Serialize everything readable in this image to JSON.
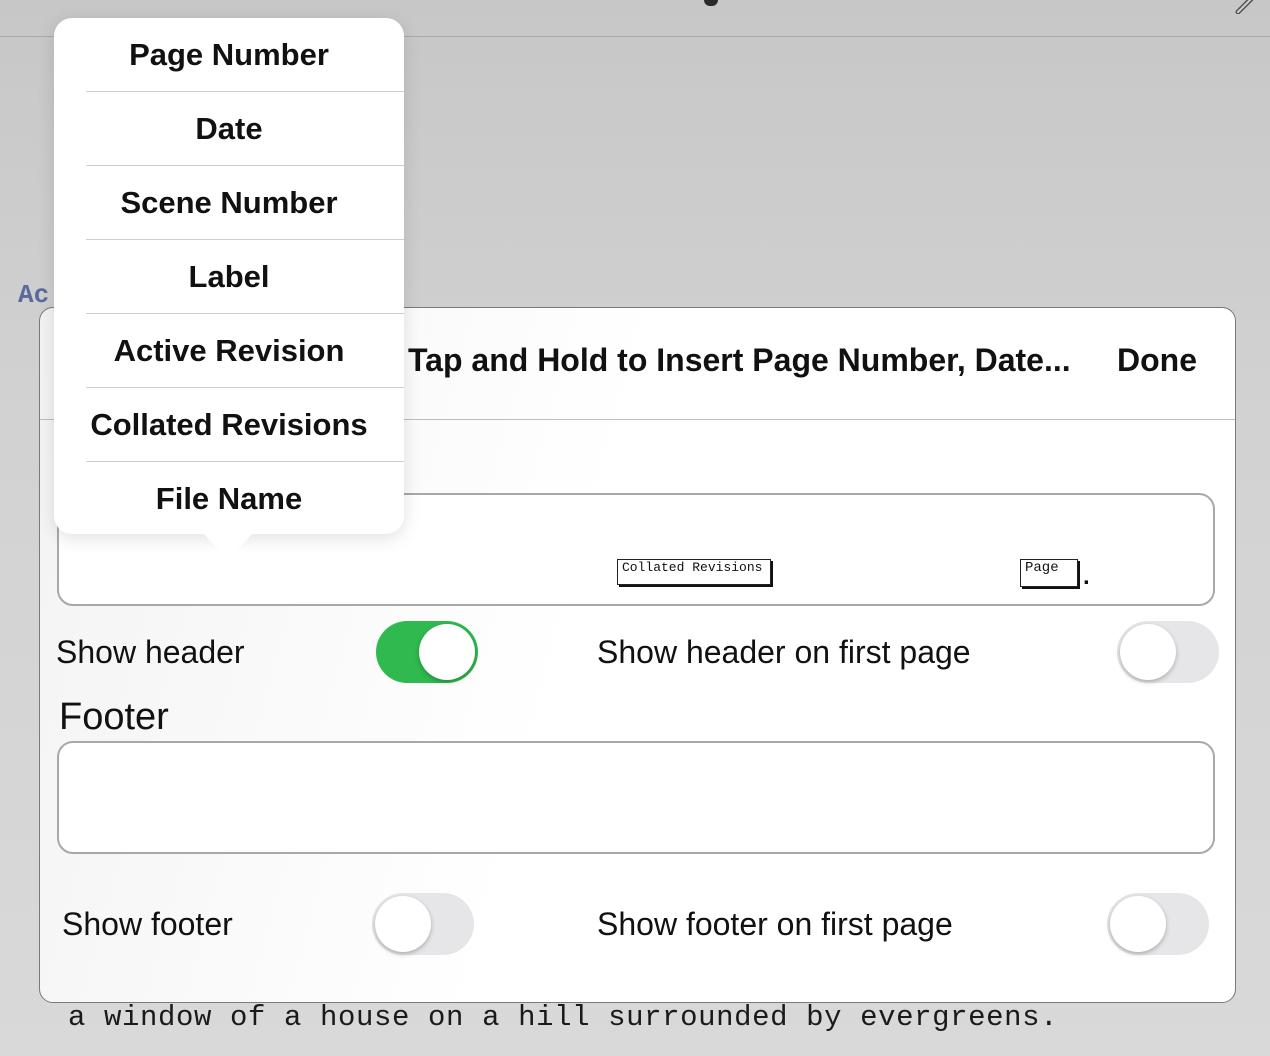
{
  "background": {
    "partial_heading": "Ac",
    "script_line": "a window of a house on a hill surrounded by evergreens."
  },
  "modal": {
    "instruction": "Tap and Hold to Insert Page Number, Date...",
    "done_label": "Done",
    "header_field": {
      "tokens": [
        "Collated Revisions",
        "Page"
      ],
      "trailing_text": "."
    },
    "show_header_label": "Show header",
    "show_header_on": true,
    "show_header_first_label": "Show header on first page",
    "show_header_first_on": false,
    "footer_label": "Footer",
    "footer_value": "",
    "show_footer_label": "Show footer",
    "show_footer_on": false,
    "show_footer_first_label": "Show footer on first page",
    "show_footer_first_on": false
  },
  "popover": {
    "items": [
      {
        "label": "Page Number"
      },
      {
        "label": "Date"
      },
      {
        "label": "Scene Number"
      },
      {
        "label": "Label"
      },
      {
        "label": "Active Revision"
      },
      {
        "label": "Collated Revisions"
      },
      {
        "label": "File Name"
      }
    ]
  },
  "colors": {
    "toggle_on": "#2fb94f",
    "toggle_off": "#e6e6e9",
    "heading_blue": "#5b6a9a"
  }
}
